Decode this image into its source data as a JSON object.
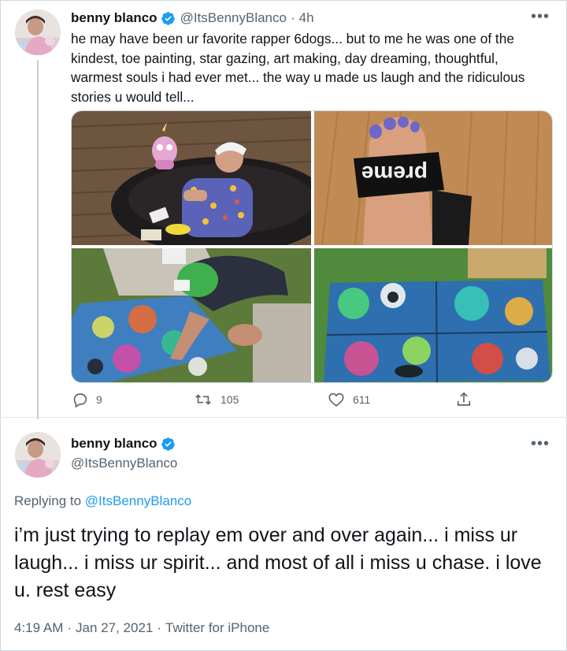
{
  "tweet": {
    "author_name": "benny blanco",
    "author_handle": "@ItsBennyBlanco",
    "separator": "·",
    "time_ago": "4h",
    "text": "he may have been ur favorite rapper 6dogs... but to me he was one of the kindest, toe painting, star gazing, art making, day dreaming, thoughtful, warmest souls i had ever met... the way u made us laugh and the ridiculous stories u would tell...",
    "more_icon": "more-horizontal-icon",
    "slide_text": "preme",
    "actions": {
      "reply_count": "9",
      "retweet_count": "105",
      "like_count": "611"
    }
  },
  "reply": {
    "author_name": "benny blanco",
    "author_handle": "@ItsBennyBlanco",
    "replying_prefix": "Replying to",
    "replying_to": "@ItsBennyBlanco",
    "text": "i’m just trying to replay em over and over again... i miss ur laugh... i miss ur spirit... and most of all i miss u chase. i love u. rest easy",
    "time": "4:19 AM",
    "date": "Jan 27, 2021",
    "client": "Twitter for iPhone",
    "separator": "·"
  },
  "colors": {
    "verified_blue": "#1d9bf0",
    "secondary_text": "#536471",
    "link": "#1d9bf0"
  }
}
